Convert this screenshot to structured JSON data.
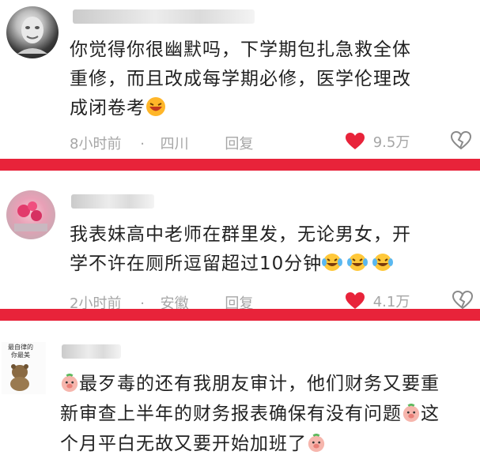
{
  "colors": {
    "separator": "#e8233a",
    "like_heart": "#e8233a",
    "meta_gray": "#a6a6a6",
    "text": "#222222"
  },
  "comments": [
    {
      "text_line1": "你觉得你很幽默吗，下学期包扎急救全体",
      "text_line2": "重修，而且改成每学期必修，医学伦理改",
      "text_line3": "成闭卷考",
      "time": "8小时前",
      "dot": "·",
      "location": "四川",
      "reply": "回复",
      "likes": "9.5万"
    },
    {
      "text_line1": "我表妹高中老师在群里发，无论男女，开",
      "text_line2": "学不许在厕所逗留超过10分钟",
      "time": "2小时前",
      "dot": "·",
      "location": "安徽",
      "reply": "回复",
      "likes": "4.1万"
    },
    {
      "avatar_text_line1": "最自律的",
      "avatar_text_line2": "你最美",
      "text_line1": "最歹毒的还有我朋友审计，他们财务又要重",
      "text_line2a": "新审查上半年的财务报表确保有没有问题",
      "text_line2b": "这",
      "text_line3": "个月平白无故又要开始加班了"
    }
  ],
  "icons": [
    "avatar-statue-icon",
    "heart-filled-icon",
    "broken-heart-icon",
    "face-emoji-icon",
    "tears-laugh-emoji-icon",
    "pig-face-emoji-icon"
  ]
}
